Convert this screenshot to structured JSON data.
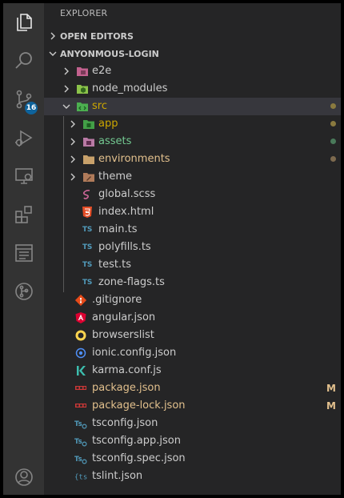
{
  "explorer": {
    "title": "EXPLORER"
  },
  "sections": {
    "open_editors": "OPEN EDITORS",
    "project": "ANYONMOUS-LOGIN"
  },
  "activity_bar": {
    "scm_badge": "16",
    "items": [
      "explorer-icon",
      "search-icon",
      "source-control-icon",
      "run-debug-icon",
      "remote-explorer-icon",
      "extensions-icon",
      "browser-preview-icon",
      "git-graph-icon",
      "account-icon"
    ]
  },
  "colors": {
    "folder_modified": "#cca700",
    "folder_untracked": "#73c991",
    "file_modified": "#e2c08d",
    "default_text": "#cccccc",
    "selected_row": "#37373d",
    "badge": "#0e639c"
  },
  "tree": [
    {
      "label": "e2e",
      "type": "folder",
      "icon": "folder-e2e-icon"
    },
    {
      "label": "node_modules",
      "type": "folder",
      "icon": "folder-node-icon"
    },
    {
      "label": "src",
      "type": "folder-open",
      "icon": "folder-src-icon",
      "status": "dot"
    },
    {
      "label": "app",
      "type": "folder",
      "icon": "folder-app-icon",
      "status": "dot"
    },
    {
      "label": "assets",
      "type": "folder",
      "icon": "folder-assets-icon",
      "status": "dot"
    },
    {
      "label": "environments",
      "type": "folder",
      "icon": "folder-environments-icon",
      "status": "dot"
    },
    {
      "label": "theme",
      "type": "folder",
      "icon": "folder-theme-icon"
    },
    {
      "label": "global.scss",
      "type": "file",
      "icon": "sass-file-icon"
    },
    {
      "label": "index.html",
      "type": "file",
      "icon": "html-file-icon"
    },
    {
      "label": "main.ts",
      "type": "file",
      "icon": "typescript-file-icon"
    },
    {
      "label": "polyfills.ts",
      "type": "file",
      "icon": "typescript-file-icon"
    },
    {
      "label": "test.ts",
      "type": "file",
      "icon": "typescript-file-icon"
    },
    {
      "label": "zone-flags.ts",
      "type": "file",
      "icon": "typescript-file-icon"
    },
    {
      "label": ".gitignore",
      "type": "file",
      "icon": "git-file-icon"
    },
    {
      "label": "angular.json",
      "type": "file",
      "icon": "angular-file-icon"
    },
    {
      "label": "browserslist",
      "type": "file",
      "icon": "browserslist-file-icon"
    },
    {
      "label": "ionic.config.json",
      "type": "file",
      "icon": "ionic-file-icon"
    },
    {
      "label": "karma.conf.js",
      "type": "file",
      "icon": "karma-file-icon"
    },
    {
      "label": "package.json",
      "type": "file",
      "icon": "npm-file-icon",
      "status": "M"
    },
    {
      "label": "package-lock.json",
      "type": "file",
      "icon": "npm-file-icon",
      "status": "M"
    },
    {
      "label": "tsconfig.json",
      "type": "file",
      "icon": "tsconfig-file-icon"
    },
    {
      "label": "tsconfig.app.json",
      "type": "file",
      "icon": "tsconfig-file-icon"
    },
    {
      "label": "tsconfig.spec.json",
      "type": "file",
      "icon": "tsconfig-file-icon"
    },
    {
      "label": "tslint.json",
      "type": "file",
      "icon": "tslint-file-icon"
    }
  ]
}
